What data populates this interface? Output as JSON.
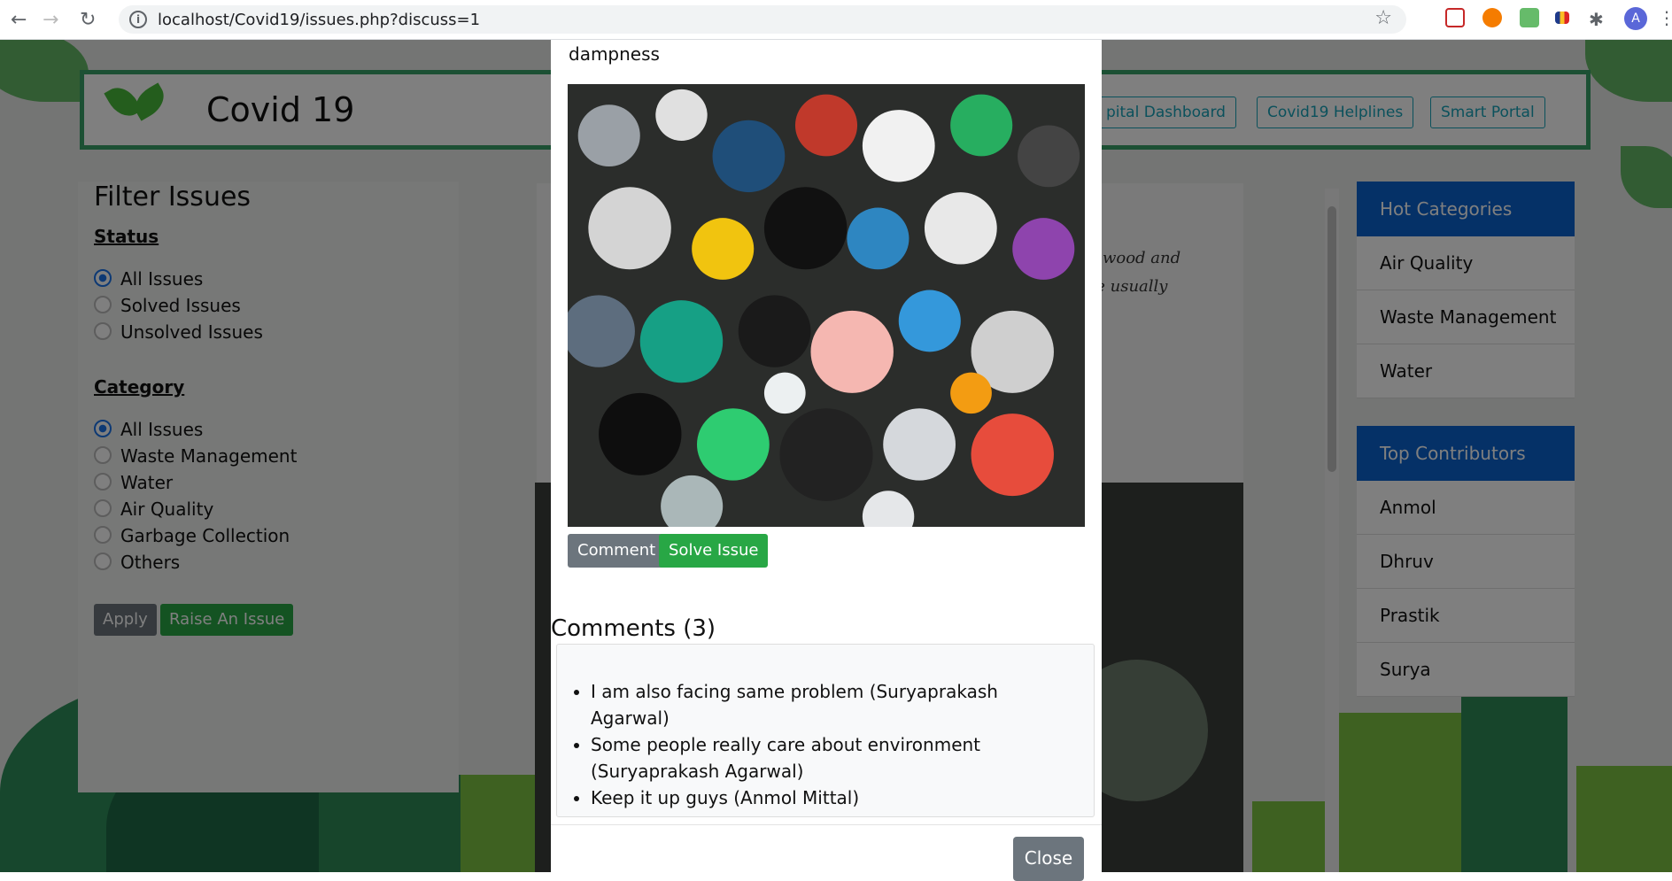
{
  "browser": {
    "url": "localhost/Covid19/issues.php?discuss=1",
    "avatar_letter": "A"
  },
  "header": {
    "brand": "Covid 19",
    "nav": [
      "pital Dashboard",
      "Covid19 Helplines",
      "Smart Portal"
    ]
  },
  "filter": {
    "title": "Filter Issues",
    "status_label": "Status",
    "status_options": [
      "All Issues",
      "Solved Issues",
      "Unsolved Issues"
    ],
    "category_label": "Category",
    "category_options": [
      "All Issues",
      "Waste Management",
      "Water",
      "Air Quality",
      "Garbage Collection",
      "Others"
    ],
    "apply": "Apply",
    "raise": "Raise An Issue"
  },
  "issue": {
    "text_line1": "s wood and",
    "text_line2": "te usually"
  },
  "sidebar": {
    "hot_title": "Hot Categories",
    "hot_items": [
      "Air Quality",
      "Waste Management",
      "Water"
    ],
    "top_title": "Top Contributors",
    "top_items": [
      "Anmol",
      "Dhruv",
      "Prastik",
      "Surya"
    ]
  },
  "modal": {
    "top_text": "dampness",
    "comment_btn": "Comment",
    "solve_btn": "Solve Issue",
    "comments_title": "Comments (3)",
    "comments": [
      "I am also facing same problem (Suryaprakash Agarwal)",
      "Some people really care about environment (Suryaprakash Agarwal)",
      "Keep it up guys (Anmol Mittal)"
    ],
    "close": "Close"
  },
  "colors": {
    "accent_green": "#28a745",
    "header_blue": "#0b63ce",
    "outline_teal": "#17a2b8"
  }
}
